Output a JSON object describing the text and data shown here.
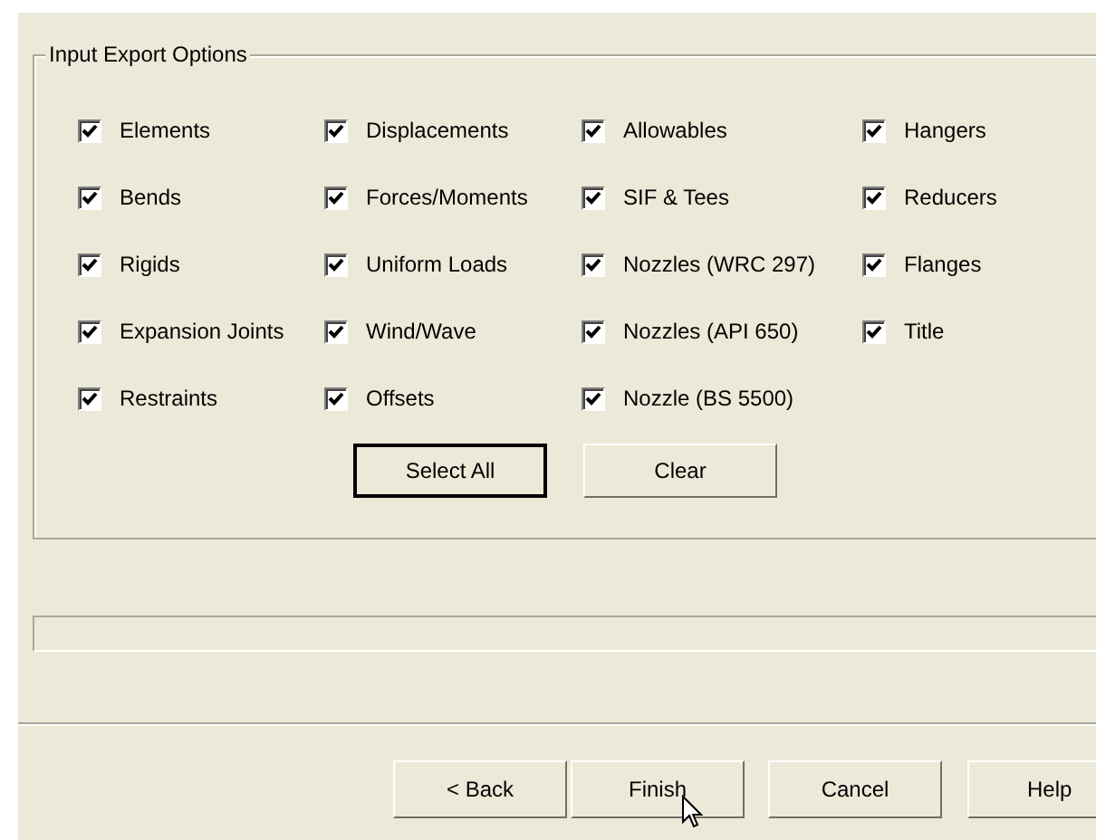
{
  "group": {
    "title": "Input Export Options",
    "columns": [
      [
        {
          "label": "Elements",
          "checked": true
        },
        {
          "label": "Bends",
          "checked": true
        },
        {
          "label": "Rigids",
          "checked": true
        },
        {
          "label": "Expansion Joints",
          "checked": true
        },
        {
          "label": "Restraints",
          "checked": true
        }
      ],
      [
        {
          "label": "Displacements",
          "checked": true
        },
        {
          "label": "Forces/Moments",
          "checked": true
        },
        {
          "label": "Uniform Loads",
          "checked": true
        },
        {
          "label": "Wind/Wave",
          "checked": true
        },
        {
          "label": "Offsets",
          "checked": true
        }
      ],
      [
        {
          "label": "Allowables",
          "checked": true
        },
        {
          "label": "SIF & Tees",
          "checked": true
        },
        {
          "label": "Nozzles (WRC 297)",
          "checked": true
        },
        {
          "label": "Nozzles (API 650)",
          "checked": true
        },
        {
          "label": "Nozzle (BS 5500)",
          "checked": true
        }
      ],
      [
        {
          "label": "Hangers",
          "checked": true
        },
        {
          "label": "Reducers",
          "checked": true
        },
        {
          "label": "Flanges",
          "checked": true
        },
        {
          "label": "Title",
          "checked": true
        }
      ]
    ],
    "buttons": [
      {
        "label": "Select All",
        "default": true
      },
      {
        "label": "Clear",
        "default": false
      }
    ]
  },
  "progress": {
    "level": 0
  },
  "footer_buttons": [
    {
      "label": "< Back"
    },
    {
      "label": "Finish"
    },
    {
      "label": "Cancel"
    },
    {
      "label": "Help"
    }
  ]
}
